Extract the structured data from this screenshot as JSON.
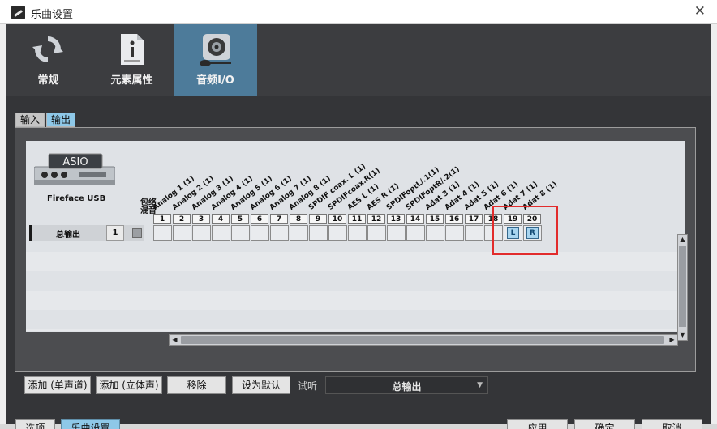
{
  "window": {
    "title": "乐曲设置",
    "close": "✕"
  },
  "main_tabs": [
    {
      "label": "常规",
      "icon": "refresh-arrows-icon"
    },
    {
      "label": "元素属性",
      "icon": "info-document-icon"
    },
    {
      "label": "音频I/O",
      "icon": "speaker-mic-icon"
    }
  ],
  "sub_tabs": {
    "input": "输入",
    "output": "输出"
  },
  "device": {
    "logo_text": "ASIO",
    "name": "Fireface USB"
  },
  "mute_label": "包络\n混音",
  "output_row": {
    "name": "总输出",
    "number": "1"
  },
  "channels": [
    {
      "num": "1",
      "name": "Analog 1 (1)"
    },
    {
      "num": "2",
      "name": "Analog 2 (1)"
    },
    {
      "num": "3",
      "name": "Analog 3 (1)"
    },
    {
      "num": "4",
      "name": "Analog 4 (1)"
    },
    {
      "num": "5",
      "name": "Analog 5 (1)"
    },
    {
      "num": "6",
      "name": "Analog 6 (1)"
    },
    {
      "num": "7",
      "name": "Analog 7 (1)"
    },
    {
      "num": "8",
      "name": "Analog 8 (1)"
    },
    {
      "num": "9",
      "name": "SPDIF coax. L (1)"
    },
    {
      "num": "10",
      "name": "SPDIFcoax.R(1)"
    },
    {
      "num": "11",
      "name": "AES L (1)"
    },
    {
      "num": "12",
      "name": "AES R (1)"
    },
    {
      "num": "13",
      "name": "SPDIFoptL/.1(1)"
    },
    {
      "num": "14",
      "name": "SPDIFoptR/.2(1)"
    },
    {
      "num": "15",
      "name": "Adat 3 (1)"
    },
    {
      "num": "16",
      "name": "Adat 4 (1)"
    },
    {
      "num": "17",
      "name": "Adat 5 (1)"
    },
    {
      "num": "18",
      "name": "Adat 6 (1)"
    },
    {
      "num": "19",
      "name": "Adat 7 (1)"
    },
    {
      "num": "20",
      "name": "Adat 8 (1)"
    }
  ],
  "assignments": {
    "19": "L",
    "20": "R"
  },
  "buttons": {
    "add_mono": "添加 (单声道)",
    "add_stereo": "添加 (立体声)",
    "remove": "移除",
    "set_default": "设为默认",
    "options": "选项",
    "song_setup": "乐曲设置",
    "apply": "应用",
    "ok": "确定",
    "cancel": "取消"
  },
  "audition": {
    "label": "试听",
    "value": "总输出"
  },
  "colors": {
    "accent": "#4d7b9a",
    "highlight": "#e22c2c",
    "button_active": "#8ec8e8"
  }
}
